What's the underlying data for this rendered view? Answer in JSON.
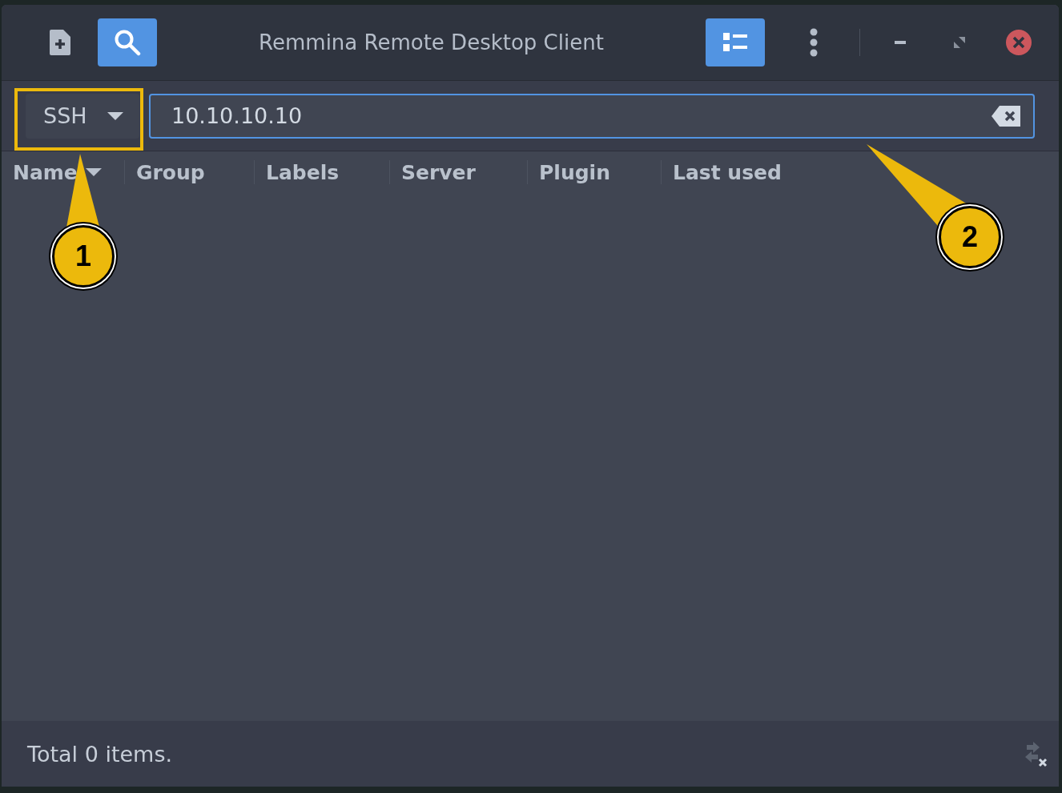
{
  "window": {
    "title": "Remmina Remote Desktop Client"
  },
  "search_toggle": {
    "selected": true
  },
  "view_toggle": {
    "selected": true
  },
  "protocol_dropdown": {
    "value": "SSH"
  },
  "address_field": {
    "value": "10.10.10.10"
  },
  "columns": [
    {
      "label": "Name",
      "sorted": true
    },
    {
      "label": "Group",
      "sorted": false
    },
    {
      "label": "Labels",
      "sorted": false
    },
    {
      "label": "Server",
      "sorted": false
    },
    {
      "label": "Plugin",
      "sorted": false
    },
    {
      "label": "Last used",
      "sorted": false
    }
  ],
  "status_bar": {
    "text": "Total 0 items."
  },
  "annotations": [
    {
      "label": "1"
    },
    {
      "label": "2"
    }
  ]
}
